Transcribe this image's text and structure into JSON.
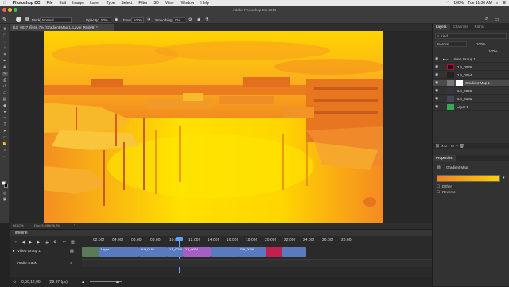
{
  "menubar": {
    "app": "Photoshop CC",
    "items": [
      "File",
      "Edit",
      "Image",
      "Layer",
      "Type",
      "Select",
      "Filter",
      "3D",
      "View",
      "Window",
      "Help"
    ],
    "clock": "Tue 11:30 AM",
    "battery": "100%"
  },
  "window": {
    "title": "Adobe Photoshop CC 2018"
  },
  "options": {
    "mode_label": "Mode:",
    "mode_value": "Normal",
    "opacity_label": "Opacity:",
    "opacity_value": "50%",
    "flow_label": "Flow:",
    "flow_value": "100%",
    "smoothing_label": "Smoothing:",
    "smoothing_value": "0%"
  },
  "document": {
    "tab_title": "DJI_0027 @ 66.7% (Gradient Map 1, Layer Mask/8) *"
  },
  "status": {
    "zoom": "66.67%",
    "doc_size": "Doc: 5.93M/26.7M"
  },
  "layers_panel": {
    "tabs": [
      "Layers",
      "Channels",
      "Paths"
    ],
    "kind_label": "Kind",
    "blend": "Normal",
    "opacity": "100%",
    "fill": "100%",
    "layers": [
      {
        "name": "Video Group 1",
        "type": "group"
      },
      {
        "name": "DJI_0026",
        "type": "video"
      },
      {
        "name": "DJI_0054",
        "type": "video"
      },
      {
        "name": "Gradient Map 1",
        "type": "adjustment"
      },
      {
        "name": "DJI_0026",
        "type": "video"
      },
      {
        "name": "DJI_0181",
        "type": "video"
      },
      {
        "name": "Layer 1",
        "type": "image"
      }
    ]
  },
  "properties_panel": {
    "title": "Properties",
    "subtitle": "Gradient Map",
    "dither": "Dither",
    "reverse": "Reverse"
  },
  "timeline": {
    "title": "Timeline",
    "ruler": [
      "02:00f",
      "04:00f",
      "06:00f",
      "08:00f",
      "10:00f",
      "12:00f",
      "14:00f",
      "16:00f",
      "18:00f",
      "20:00f",
      "22:00f",
      "24:00f",
      "26:00f",
      "28:00f"
    ],
    "tracks": [
      "Video Group 1",
      "Audio Track"
    ],
    "clips": [
      "Layer 1",
      "DJI_0181",
      "DJI_0026",
      "DJI_0054",
      "DJI_0026"
    ],
    "timecode": "0;00;12;00",
    "fps": "(29.97 fps)"
  },
  "colors": {
    "accent": "#f7a21b",
    "orange": "#f4811f",
    "yellow": "#ffd000"
  }
}
